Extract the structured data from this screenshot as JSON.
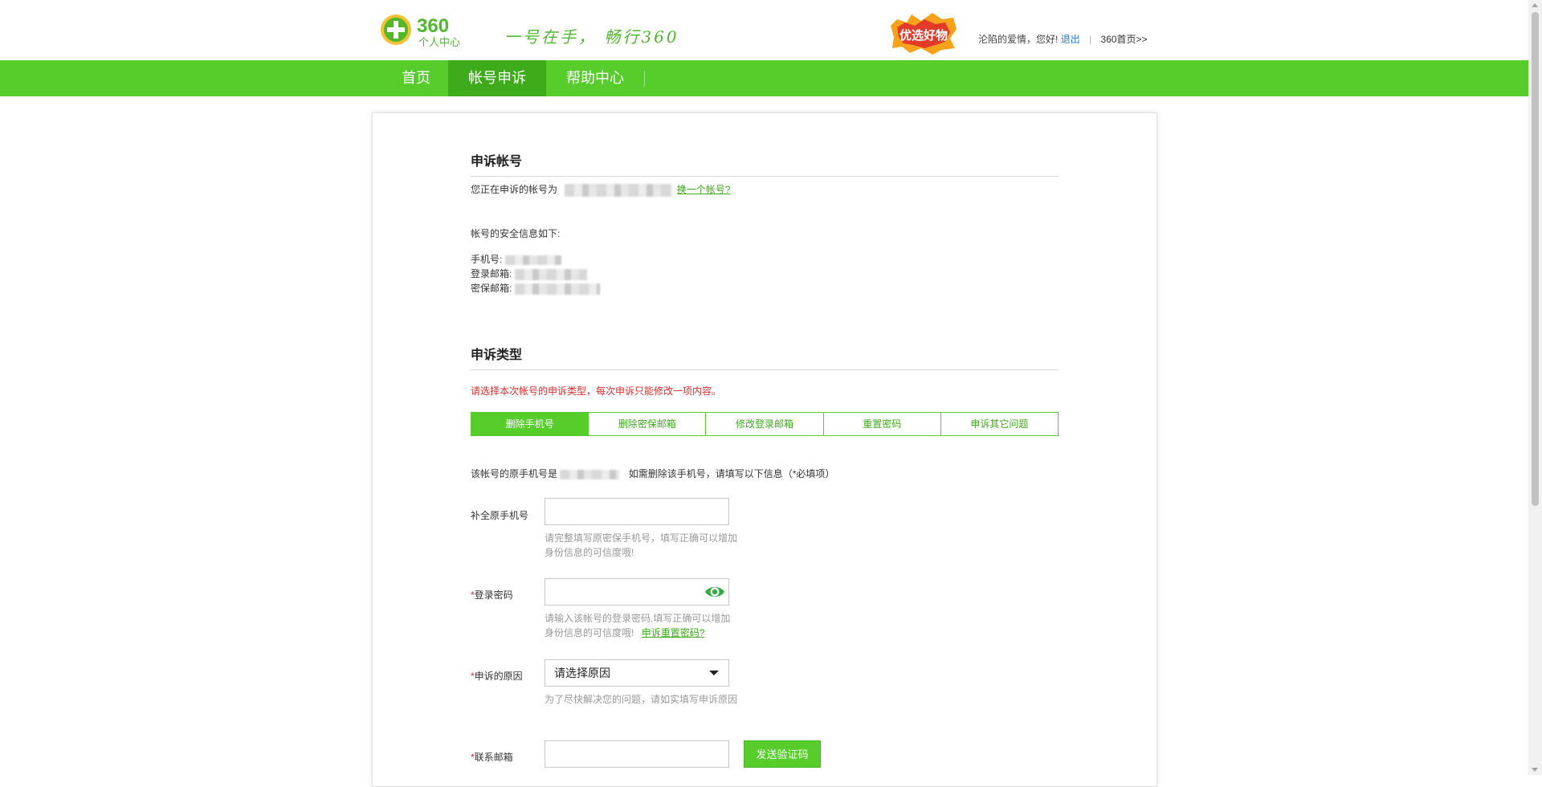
{
  "header": {
    "logo_text": "360",
    "logo_sub": "个人中心",
    "slogan": "一号在手， 畅行360",
    "promo_text": "优选好物",
    "greeting": "沦陷的爱情，您好!",
    "logout": "退出",
    "separator": "|",
    "home_link": "360首页>>"
  },
  "nav": {
    "items": [
      {
        "label": "首页",
        "active": false
      },
      {
        "label": "帐号申诉",
        "active": true
      },
      {
        "label": "帮助中心",
        "active": false
      }
    ]
  },
  "account_section": {
    "title": "申诉帐号",
    "current_label": "您正在申诉的帐号为",
    "change_link": "换一个帐号?",
    "security_intro": "帐号的安全信息如下:",
    "phone_label": "手机号:",
    "login_email_label": "登录邮箱:",
    "secure_email_label": "密保邮箱:"
  },
  "type_section": {
    "title": "申诉类型",
    "notice": "请选择本次帐号的申诉类型，每次申诉只能修改一项内容。",
    "tabs": [
      {
        "label": "删除手机号",
        "active": true
      },
      {
        "label": "删除密保邮箱",
        "active": false
      },
      {
        "label": "修改登录邮箱",
        "active": false
      },
      {
        "label": "重置密码",
        "active": false
      },
      {
        "label": "申诉其它问题",
        "active": false
      }
    ],
    "original_phone_prefix": "该帐号的原手机号是",
    "original_phone_suffix": "如需删除该手机号，请填写以下信息（*必填项）"
  },
  "form": {
    "phone": {
      "label": "补全原手机号",
      "value": "",
      "hint": "请完整填写原密保手机号，填写正确可以增加身份信息的可信度哦!"
    },
    "password": {
      "required_mark": "*",
      "label": "登录密码",
      "value": "",
      "hint": "请输入该帐号的登录密码,填写正确可以增加身份信息的可信度哦!",
      "hint_link": "申诉重置密码?"
    },
    "reason": {
      "required_mark": "*",
      "label": "申诉的原因",
      "selected": "请选择原因",
      "hint": "为了尽快解决您的问题，请如实填写申诉原因"
    },
    "email": {
      "required_mark": "*",
      "label": "联系邮箱",
      "value": "",
      "button": "发送验证码"
    }
  },
  "colors": {
    "brand_green": "#57cd2b",
    "active_green": "#3eab1b",
    "warning_red": "#e02d2d",
    "link_blue": "#2a7ad1"
  }
}
